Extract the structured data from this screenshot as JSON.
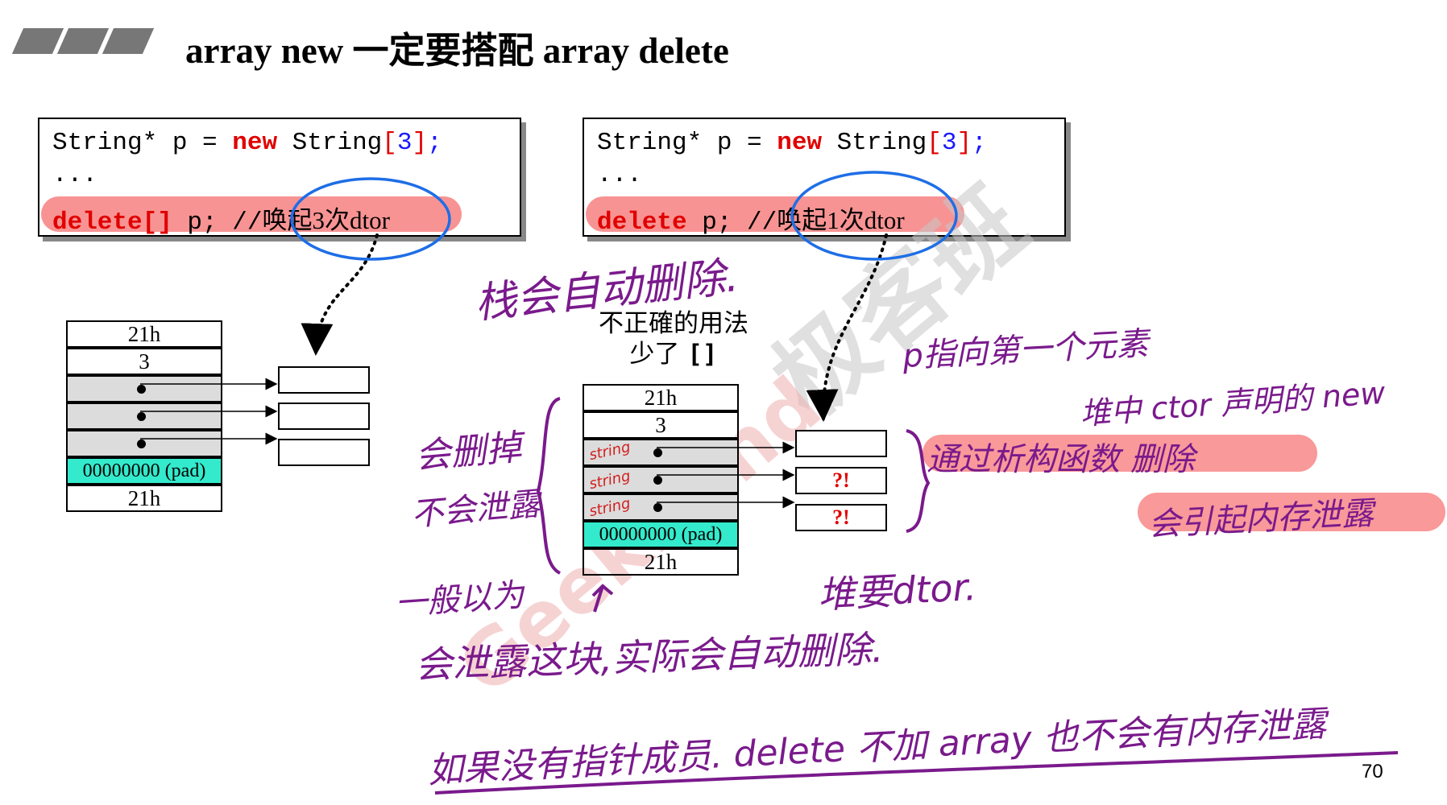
{
  "title": "array new 一定要搭配 array delete",
  "left_code": {
    "line1_a": "String* p = ",
    "line1_kw": "new",
    "line1_b": " String",
    "line1_lb": "[",
    "line1_num": "3",
    "line1_rb": "]",
    "line1_semi": ";",
    "line2": "...",
    "line3_kw": "delete[]",
    "line3_b": " p; //",
    "line3_cmt": "唤起3次dtor"
  },
  "right_code": {
    "line1_a": "String* p = ",
    "line1_kw": "new",
    "line1_b": " String",
    "line1_lb": "[",
    "line1_num": "3",
    "line1_rb": "]",
    "line1_semi": ";",
    "line2": "...",
    "line3_kw": "delete",
    "line3_b": " p; //",
    "line3_cmt": "唤起1次dtor"
  },
  "left_memory": {
    "cells": [
      "21h",
      "3",
      "",
      "",
      "",
      "00000000 (pad)",
      "21h"
    ]
  },
  "right_memory": {
    "cells": [
      "21h",
      "3",
      "",
      "",
      "",
      "00000000 (pad)",
      "21h"
    ],
    "string_notes": [
      "string",
      "string",
      "string"
    ],
    "object_marks": [
      "",
      "?!",
      "?!"
    ]
  },
  "incorrect_label": {
    "line1": "不正確的用法",
    "line2_text": "少了 ",
    "line2_bracket": "[]"
  },
  "handwriting": {
    "stack_auto_delete": "栈会自动删除.",
    "p_points_first": "p指向第一个元素",
    "heap_ctor_new": "堆中 ctor 声明的 new",
    "dtor_delete": "通过析构函数 删除",
    "memory_leak": "会引起内存泄露",
    "will_delete_1": "会删掉",
    "will_delete_2": "不会泄露",
    "heap_need_dtor": "堆要dtor.",
    "general_belief_1": "一般以为",
    "general_belief_2": "会泄露这块,实际会自动删除.",
    "conclusion": "如果没有指针成员. delete 不加 array 也不会有内存泄露"
  },
  "watermark": {
    "text_cn": "极客班",
    "text_en": "GeekBand"
  },
  "page_number": "70",
  "colors": {
    "keyword_red": "#e00000",
    "number_blue": "#1a1aff",
    "highlight_pink": "#f78080",
    "pad_cyan": "#33eacc",
    "ink_purple": "#7a1a8c",
    "ink_blue": "#1e6ee6"
  }
}
